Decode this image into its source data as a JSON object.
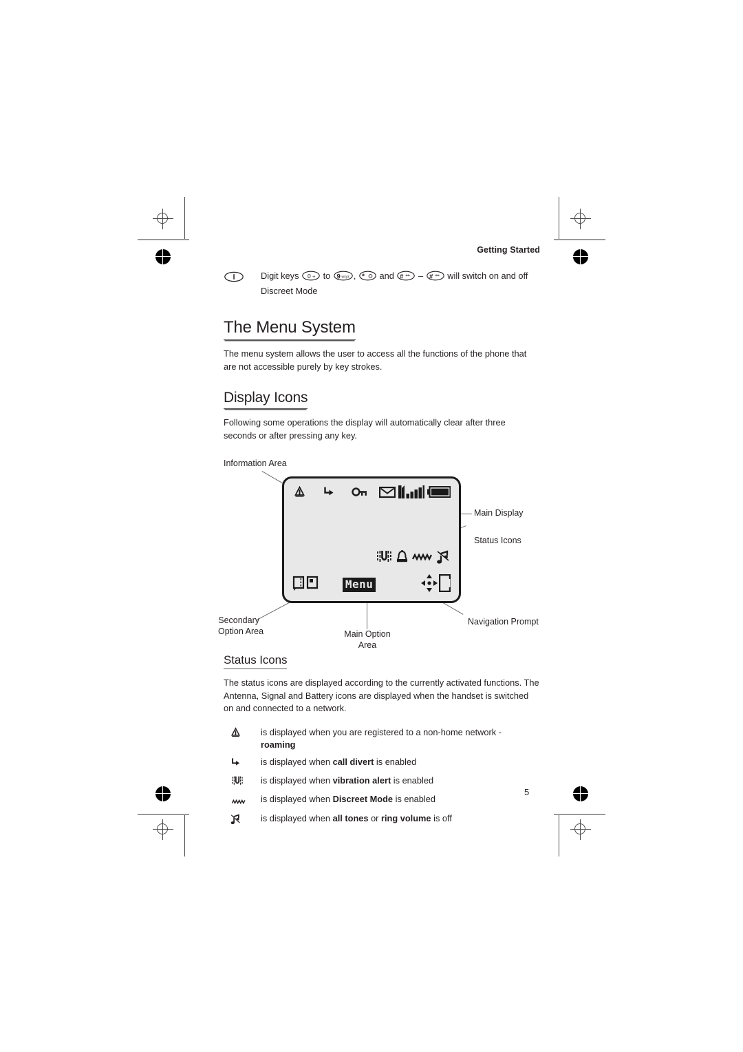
{
  "page": {
    "running_head": "Getting Started",
    "page_number": "5"
  },
  "note": {
    "key_icon": "info-key-icon",
    "text_parts": {
      "a": "Digit keys",
      "key0": "0+",
      "b": "to",
      "key9": "9wxyz",
      "comma": ",",
      "keystar": "*",
      "c": "and",
      "keyhash1": "#",
      "dash": "–",
      "keyhash2": "#",
      "d": "will switch on and off Discreet Mode"
    }
  },
  "sections": {
    "menu_system": {
      "heading": "The Menu System",
      "body": "The menu system allows the user to access all the functions of the phone that are not accessible purely by key strokes."
    },
    "display_icons": {
      "heading": "Display Icons",
      "body": "Following some operations the display will automatically clear after three seconds or after pressing any key."
    },
    "status_icons": {
      "heading": "Status Icons",
      "body": "The status icons are displayed according to the currently activated functions. The Antenna, Signal and Battery icons are displayed when the handset is switched on and connected to a network."
    }
  },
  "figure": {
    "labels": {
      "information_area": "Information Area",
      "main_display": "Main Display",
      "status_icons": "Status Icons",
      "secondary_option_area_l1": "Secondary",
      "secondary_option_area_l2": "Option Area",
      "main_option_area_l1": "Main Option",
      "main_option_area_l2": "Area",
      "navigation_prompt": "Navigation Prompt"
    },
    "screen": {
      "menu_text": "Menu",
      "info_icons": [
        "roaming-icon",
        "call-divert-icon",
        "keylock-on-icon",
        "envelope-icon",
        "signal-bars-icon",
        "battery-icon"
      ],
      "status_icons": [
        "vibration-alert-icon",
        "bell-icon",
        "discreet-mode-icon",
        "tones-off-icon"
      ],
      "secondary_icons": [
        "phonebook-icon",
        "sim-card-icon"
      ],
      "nav_icons": [
        "navigation-diamond-icon",
        "clear-c-icon"
      ]
    },
    "colors": {
      "screen_fill": "#e8e8e8",
      "screen_border": "#1a1a1a",
      "leader_line": "#6d6a6d"
    }
  },
  "icon_list": [
    {
      "icon": "roaming-icon",
      "pre": "is displayed when you are registered to a non-home network -",
      "bold": "roaming",
      "post": "",
      "bold_on_new_line": true
    },
    {
      "icon": "call-divert-icon",
      "pre": "is displayed when",
      "bold": "call divert",
      "post": "is enabled",
      "bold_on_new_line": false
    },
    {
      "icon": "vibration-alert-icon",
      "pre": "is displayed when",
      "bold": "vibration alert",
      "post": "is enabled",
      "bold_on_new_line": false
    },
    {
      "icon": "discreet-mode-icon",
      "pre": "is displayed when",
      "bold": "Discreet Mode",
      "post": "is enabled",
      "bold_on_new_line": false
    },
    {
      "icon": "tones-off-icon",
      "pre": "is displayed when",
      "bold": "all tones",
      "mid": "or",
      "bold2": "ring volume",
      "post": "is off",
      "bold_on_new_line": false
    }
  ]
}
